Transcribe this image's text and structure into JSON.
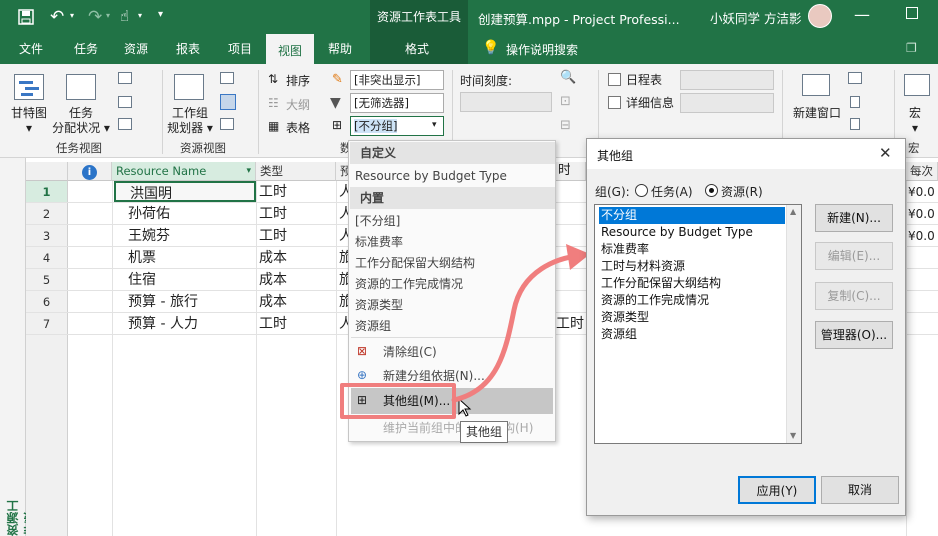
{
  "titlebar": {
    "context_title": "资源工作表工具",
    "window_title": "创建预算.mpp  -  Project Professi...",
    "user": "小妖同学 方洁影"
  },
  "tabs": [
    "文件",
    "任务",
    "资源",
    "报表",
    "项目",
    "视图",
    "帮助",
    "格式"
  ],
  "tell_me": "操作说明搜索",
  "ribbon": {
    "gantt_label": "甘特图",
    "task_usage_label1": "任务",
    "task_usage_label2": "分配状况",
    "task_views_group": "任务视图",
    "team_planner_label1": "工作组",
    "team_planner_label2": "规划器",
    "resource_views_group": "资源视图",
    "sort_label": "排序",
    "outline_label": "大纲",
    "tables_label": "表格",
    "highlight_value": "[非突出显示]",
    "filter_value": "[无筛选器]",
    "group_value": "[不分组]",
    "data_group_partial": "数",
    "timescale_label": "时间刻度:",
    "schedule_label": "日程表",
    "details_label": "详细信息",
    "new_window_label": "新建窗口",
    "macro_label": "宏",
    "macro_group": "宏"
  },
  "sheet": {
    "side_label": "资源工作表",
    "info_icon": "i",
    "headers": [
      "Resource Name",
      "类型",
      "预",
      "",
      "",
      "",
      "",
      "",
      "",
      "每次"
    ],
    "rows": [
      {
        "num": "1",
        "name": "洪国明",
        "type": "工时",
        "col3": "人",
        "cost": "¥0.0"
      },
      {
        "num": "2",
        "name": "孙荷佑",
        "type": "工时",
        "col3": "人",
        "cost": "¥0.0"
      },
      {
        "num": "3",
        "name": "王婉芬",
        "type": "工时",
        "col3": "人",
        "cost": "¥0.0"
      },
      {
        "num": "4",
        "name": "机票",
        "type": "成本",
        "col3": "旅",
        "cost": ""
      },
      {
        "num": "5",
        "name": "住宿",
        "type": "成本",
        "col3": "旅",
        "cost": ""
      },
      {
        "num": "6",
        "name": "预算 - 旅行",
        "type": "成本",
        "col3": "旅",
        "cost": ""
      },
      {
        "num": "7",
        "name": "预算 - 人力",
        "type": "工时",
        "col3": "人",
        "cost": "",
        "col4": "工时"
      }
    ],
    "row1_extra": "时"
  },
  "dropdown_menu": {
    "custom_header": "自定义",
    "custom_items": [
      "Resource by Budget Type"
    ],
    "builtin_header": "内置",
    "builtin_items": [
      "[不分组]",
      "标准费率",
      "工作分配保留大纲结构",
      "资源的工作完成情况",
      "资源类型",
      "资源组"
    ],
    "clear_group": "清除组(C)",
    "new_group_by": "新建分组依据(N)...",
    "more_groups": "其他组(M)...",
    "maintain_hierarchy": "维护当前组中的层次结构(H)",
    "tooltip": "其他组"
  },
  "dialog": {
    "title": "其他组",
    "group_label": "组(G):",
    "radio_task": "任务(A)",
    "radio_resource": "资源(R)",
    "list": [
      "不分组",
      "Resource by Budget Type",
      "标准费率",
      "工时与材料资源",
      "工作分配保留大纲结构",
      "资源的工作完成情况",
      "资源类型",
      "资源组"
    ],
    "selected": "不分组",
    "btn_new": "新建(N)...",
    "btn_edit": "编辑(E)...",
    "btn_copy": "复制(C)...",
    "btn_organizer": "管理器(O)...",
    "btn_apply": "应用(Y)",
    "btn_cancel": "取消",
    "close": "✕"
  },
  "colors": {
    "brand": "#217346",
    "highlight": "#f07e7e",
    "selected": "#0078d7"
  }
}
